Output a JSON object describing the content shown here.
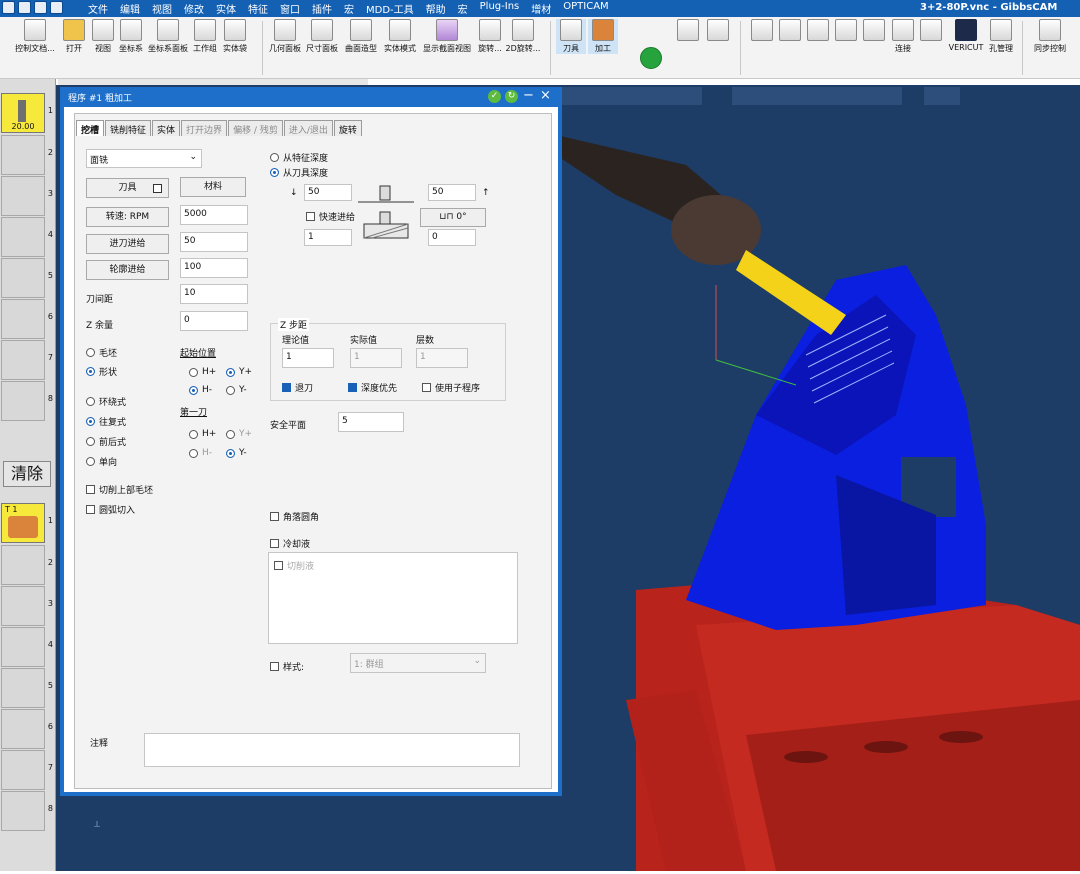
{
  "window": {
    "title": "3+2-80P.vnc - GibbsCAM"
  },
  "menu": [
    "文件",
    "编辑",
    "视图",
    "修改",
    "实体",
    "特征",
    "窗口",
    "插件",
    "宏",
    "MDD-工具",
    "帮助",
    "宏",
    "Plug-Ins",
    "增材",
    "OPTICAM"
  ],
  "ribbon": {
    "buttons": [
      "控制文档...",
      "打开",
      "视图",
      "坐标系",
      "坐标系面板",
      "工作组",
      "实体袋",
      "几何面板",
      "尺寸面板",
      "曲面造型",
      "实体模式",
      "显示截面视图",
      "旋转...",
      "2D旋转...",
      "刀具",
      "加工"
    ],
    "right_labels": [
      "VERICUT",
      "孔管理",
      "同步控制",
      "连接"
    ]
  },
  "left_panel": {
    "tool_label": "20.00",
    "slot_numbers": [
      "1",
      "2",
      "3",
      "4",
      "5",
      "6",
      "7",
      "8"
    ],
    "op_slot_numbers": [
      "1",
      "2",
      "3",
      "4",
      "5",
      "6",
      "7",
      "8"
    ],
    "clear_label": "清除",
    "op_tag": "T 1"
  },
  "dialog": {
    "title": "程序 #1 粗加工",
    "tabs": [
      "挖槽",
      "铣削特征",
      "实体",
      "打开边界",
      "偏移 / 残剪",
      "进入/退出",
      "旋转"
    ],
    "mode_select": "面铣",
    "tool_button": "刀具",
    "material_button": "材料",
    "rpm_label": "转速: RPM",
    "rpm_value": "5000",
    "feed_label": "进刀进给",
    "feed_value": "50",
    "contour_label": "轮廓进给",
    "contour_value": "100",
    "stepover_label": "刀间距",
    "stepover_value": "10",
    "zstock_label": "Z 余量",
    "zstock_value": "0",
    "radio_stock": "毛坯",
    "radio_shape": "形状",
    "start_title": "起始位置",
    "start_h_plus": "H+",
    "start_h_minus": "H-",
    "start_y_plus": "Y+",
    "start_y_minus": "Y-",
    "pattern_loop": "环绕式",
    "pattern_zigzag": "往复式",
    "pattern_oneway": "前后式",
    "pattern_single": "单向",
    "first_cut_title": "第一刀",
    "first_h_plus": "H+",
    "first_h_minus": "H-",
    "first_y_plus": "Y+",
    "first_y_minus": "Y-",
    "cut_top_stock": "切削上部毛坯",
    "arc_entry": "圆弧切入",
    "depth_from_feature": "从特征深度",
    "depth_from_tool": "从刀具深度",
    "depth_left_top": "50",
    "depth_right_top": "50",
    "rapid_in": "快速进给",
    "angle": "0°",
    "depth_left_bottom": "1",
    "depth_right_bottom": "0",
    "zstep_title": "Z 步距",
    "zstep_theory": "理论值",
    "zstep_actual": "实际值",
    "zstep_layers": "层数",
    "zstep_theory_val": "1",
    "zstep_actual_val": "1",
    "zstep_layers_val": "1",
    "retract": "退刀",
    "depth_first": "深度优先",
    "use_subprogram": "使用子程序",
    "safe_plane_label": "安全平面",
    "safe_plane_value": "5",
    "corner_round": "角落圆角",
    "coolant": "冷却液",
    "cutting_fluid": "切削液",
    "style_label": "样式:",
    "style_value": "1: 群组",
    "notes_label": "注释"
  },
  "colors": {
    "accent": "#1e6fc9",
    "viewport_bg": "#1d3c66",
    "part_blue": "#0b1fe0",
    "fixture_red": "#c1271e",
    "tool_yellow": "#f4d21a"
  }
}
